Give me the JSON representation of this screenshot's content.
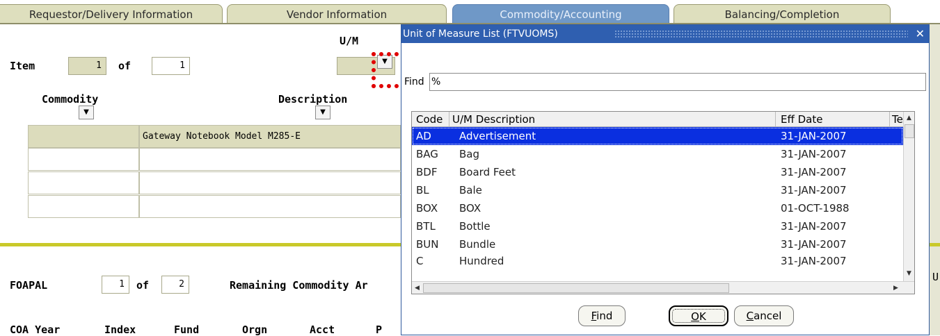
{
  "tabs": [
    {
      "label": "Requestor/Delivery Information",
      "active": false
    },
    {
      "label": "Vendor Information",
      "active": false
    },
    {
      "label": "Commodity/Accounting",
      "active": true
    },
    {
      "label": "Balancing/Completion",
      "active": false
    }
  ],
  "form": {
    "um_label": "U/M",
    "item_label": "Item",
    "item_value": "1",
    "of_label": "of",
    "item_total": "1",
    "commodity_label": "Commodity",
    "description_label": "Description",
    "description_value": "Gateway Notebook Model M285-E",
    "foapal_label": "FOAPAL",
    "foapal_value": "1",
    "foapal_of_label": "of",
    "foapal_total": "2",
    "remaining_label": "Remaining Commodity Ar",
    "col_coa_year": "COA Year",
    "col_index": "Index",
    "col_fund": "Fund",
    "col_orgn": "Orgn",
    "col_acct": "Acct",
    "col_p": "P",
    "right_partial": "U"
  },
  "dialog": {
    "title": "Unit of Measure List (FTVUOMS)",
    "close_glyph": "✕",
    "find_label": "Find",
    "find_value": "%",
    "columns": {
      "code": "Code",
      "desc": "U/M Description",
      "eff": "Eff Date",
      "extra": "Te"
    },
    "rows": [
      {
        "code": "AD",
        "desc": "Advertisement",
        "eff": "31-JAN-2007",
        "selected": true
      },
      {
        "code": "BAG",
        "desc": "Bag",
        "eff": "31-JAN-2007",
        "selected": false
      },
      {
        "code": "BDF",
        "desc": "Board Feet",
        "eff": "31-JAN-2007",
        "selected": false
      },
      {
        "code": "BL",
        "desc": "Bale",
        "eff": "31-JAN-2007",
        "selected": false
      },
      {
        "code": "BOX",
        "desc": "BOX",
        "eff": "01-OCT-1988",
        "selected": false
      },
      {
        "code": "BTL",
        "desc": "Bottle",
        "eff": "31-JAN-2007",
        "selected": false
      },
      {
        "code": "BUN",
        "desc": "Bundle",
        "eff": "31-JAN-2007",
        "selected": false
      },
      {
        "code": "C",
        "desc": "Hundred",
        "eff": "31-JAN-2007",
        "selected": false
      }
    ],
    "buttons": {
      "find": {
        "underlined": "F",
        "rest": "ind"
      },
      "ok": {
        "underlined": "O",
        "rest": "K"
      },
      "cancel": {
        "underlined": "C",
        "rest": "ancel"
      }
    }
  },
  "colors": {
    "tab_bg": "#dedfbe",
    "tab_active": "#6f98c7",
    "title_bar": "#2f5fb0",
    "selection": "#0a2fe0",
    "separator": "#c9c92a"
  }
}
